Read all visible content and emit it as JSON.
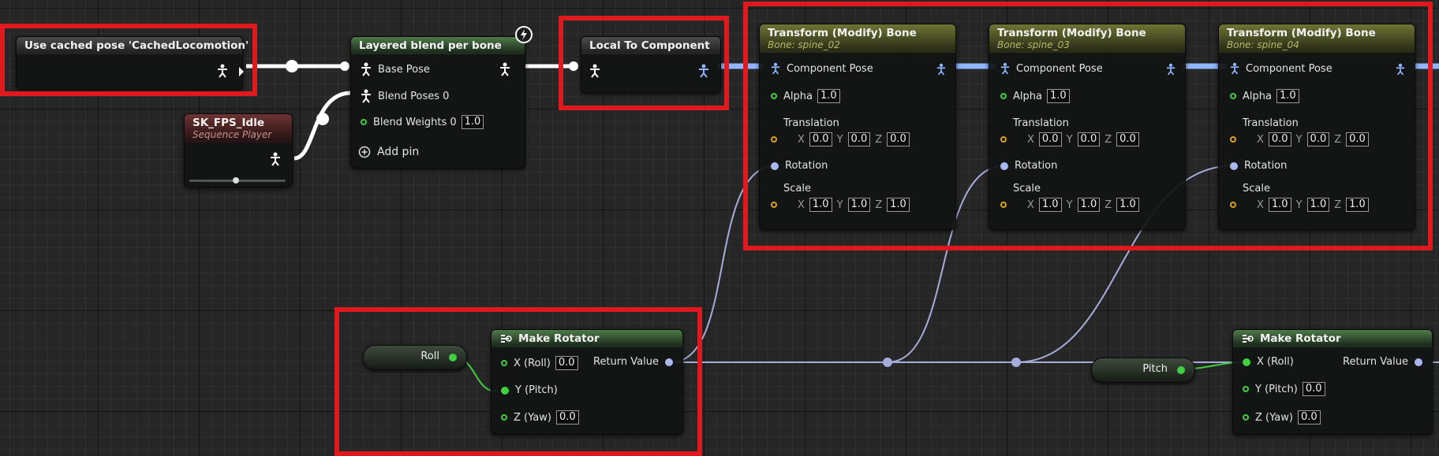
{
  "nodes": {
    "cached_pose": {
      "title": "Use cached pose 'CachedLocomotion'"
    },
    "layered_blend": {
      "title": "Layered blend per bone",
      "base_pose": "Base Pose",
      "blend_poses": "Blend Poses 0",
      "blend_weights": "Blend Weights 0",
      "blend_weights_value": "1.0",
      "add_pin": "Add pin"
    },
    "sequence": {
      "title": "SK_FPS_Idle",
      "subtitle": "Sequence Player"
    },
    "local_to_component": {
      "title": "Local To Component"
    },
    "transforms": [
      {
        "title": "Transform (Modify) Bone",
        "bone": "Bone: spine_02"
      },
      {
        "title": "Transform (Modify) Bone",
        "bone": "Bone: spine_03"
      },
      {
        "title": "Transform (Modify) Bone",
        "bone": "Bone: spine_04"
      }
    ],
    "transform_labels": {
      "component_pose": "Component Pose",
      "alpha": "Alpha",
      "alpha_value": "1.0",
      "translation": "Translation",
      "rotation": "Rotation",
      "scale": "Scale",
      "x": "X",
      "y": "Y",
      "z": "Z",
      "translation_value": "0.0",
      "scale_value": "1.0"
    },
    "make_rotator_1": {
      "title": "Make Rotator",
      "x": "X (Roll)",
      "x_value": "0.0",
      "y": "Y (Pitch)",
      "z": "Z (Yaw)",
      "z_value": "0.0",
      "ret": "Return Value"
    },
    "make_rotator_2": {
      "title": "Make Rotator",
      "x": "X (Roll)",
      "y": "Y (Pitch)",
      "y_value": "0.0",
      "z": "Z (Yaw)",
      "z_value": "0.0",
      "ret": "Return Value"
    },
    "roll_var": {
      "label": "Roll"
    },
    "pitch_var": {
      "label": "Pitch"
    }
  },
  "colors": {
    "highlight": "#e0191e",
    "exec_wire": "#ffffff",
    "pose_wire": "#8fb6ff",
    "rotator_wire": "#a6acd9",
    "float_wire": "#3fcf3f"
  },
  "icons": {
    "pose_pin": "person-icon",
    "float_pin": "ring-icon",
    "rotator_pin": "dot-icon",
    "fast_path": "lightning-icon",
    "add": "plus-circle-icon",
    "function": "function-icon"
  }
}
